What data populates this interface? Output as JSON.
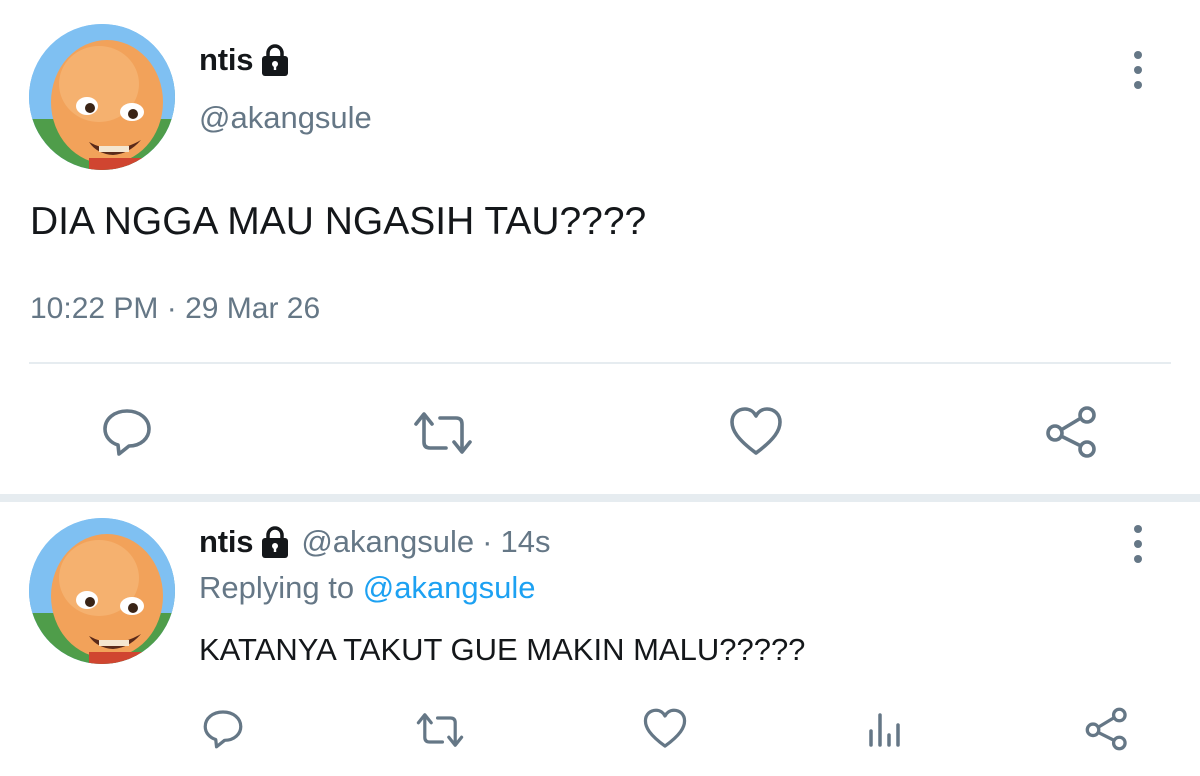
{
  "main_tweet": {
    "display_name": "ntis",
    "handle": "@akangsule",
    "text": "DIA NGGA MAU NGASIH TAU????",
    "timestamp": "10:22 PM · 29 Mar 26",
    "actions": [
      "reply-icon",
      "retweet-icon",
      "like-icon",
      "share-icon"
    ]
  },
  "reply_tweet": {
    "display_name": "ntis",
    "handle": "@akangsule",
    "separator": "·",
    "time_ago": "14s",
    "replying_prefix": "Replying to",
    "replying_to": "@akangsule",
    "text": "KATANYA TAKUT GUE MAKIN MALU?????",
    "actions": [
      "reply-icon",
      "retweet-icon",
      "like-icon",
      "analytics-icon",
      "share-icon"
    ]
  },
  "colors": {
    "text_primary": "#14171a",
    "text_secondary": "#657786",
    "link": "#1da1f2",
    "divider": "#e6ecf0",
    "icon": "#657786"
  }
}
